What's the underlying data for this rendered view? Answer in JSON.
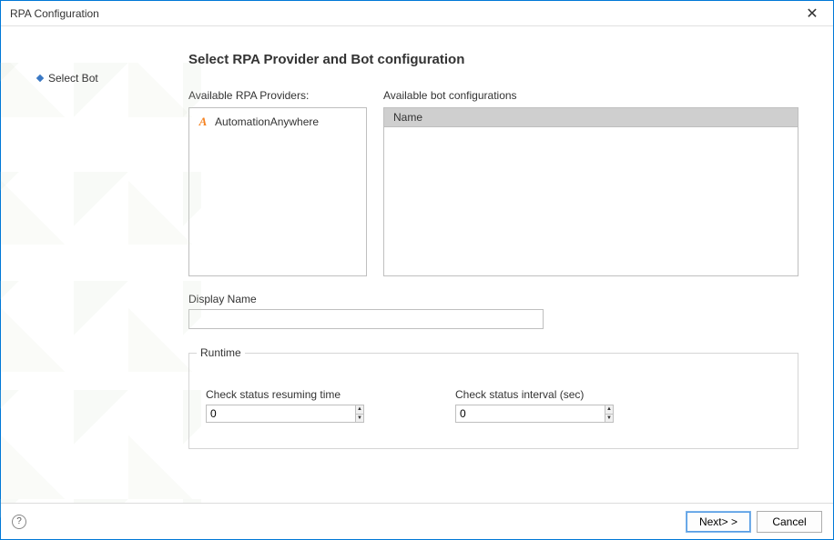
{
  "window": {
    "title": "RPA Configuration"
  },
  "sidebar": {
    "steps": [
      {
        "label": "Select Bot"
      }
    ]
  },
  "main": {
    "heading": "Select RPA Provider and Bot configuration",
    "providers_label": "Available RPA Providers:",
    "providers": [
      {
        "name": "AutomationAnywhere"
      }
    ],
    "bot_configs_label": "Available bot configurations",
    "bot_configs_header": "Name",
    "display_name_label": "Display Name",
    "display_name_value": "",
    "runtime": {
      "legend": "Runtime",
      "resuming_label": "Check status resuming time",
      "resuming_value": "0",
      "interval_label": "Check status interval (sec)",
      "interval_value": "0"
    }
  },
  "footer": {
    "help_tooltip": "?",
    "next_label": "Next> >",
    "cancel_label": "Cancel"
  }
}
